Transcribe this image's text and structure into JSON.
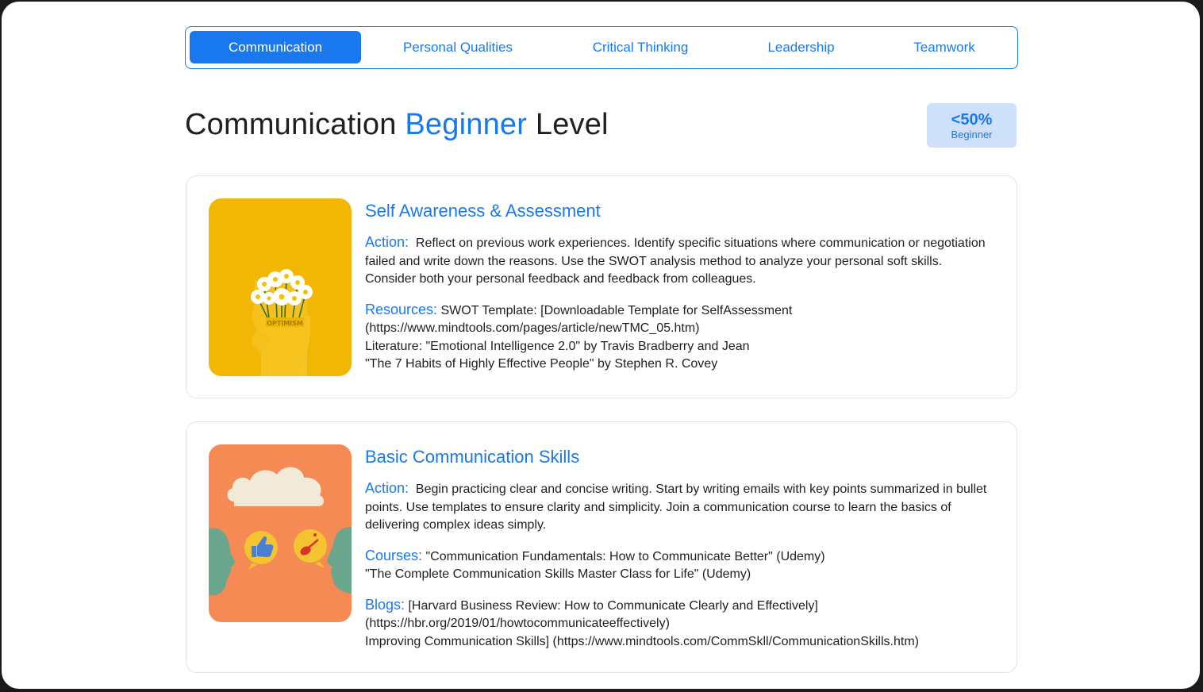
{
  "tabs": [
    {
      "label": "Communication",
      "active": true
    },
    {
      "label": "Personal Qualities",
      "active": false
    },
    {
      "label": "Critical Thinking",
      "active": false
    },
    {
      "label": "Leadership",
      "active": false
    },
    {
      "label": "Teamwork",
      "active": false
    }
  ],
  "heading": {
    "prefix": "Communication",
    "accent": "Beginner",
    "suffix": "Level"
  },
  "badge": {
    "percent": "<50%",
    "level": "Beginner"
  },
  "cards": [
    {
      "title": "Self Awareness & Assessment",
      "image_text": "OPTIMISM",
      "action_label": "Action:",
      "action_text": "Reflect on previous work experiences. Identify specific situations where communication or negotiation failed and write down the reasons. Use the SWOT analysis method to analyze your personal soft skills. Consider both your personal feedback and feedback from colleagues.",
      "resources_label": "Resources:",
      "resources_lines": [
        "SWOT Template: [Downloadable Template for SelfAssessment (https://www.mindtools.com/pages/article/newTMC_05.htm)",
        " Literature: \"Emotional Intelligence 2.0\" by Travis Bradberry and Jean",
        "\"The 7 Habits of Highly Effective People\" by Stephen R. Covey"
      ]
    },
    {
      "title": "Basic Communication Skills",
      "action_label": "Action:",
      "action_text": "Begin practicing clear and concise writing. Start by writing emails with key points summarized in bullet points. Use templates to ensure clarity and simplicity. Join a communication course to learn the basics of delivering complex ideas simply.",
      "courses_label": "Courses:",
      "courses_lines": [
        "\"Communication Fundamentals: How to Communicate Better\" (Udemy)",
        "\"The Complete Communication Skills Master Class for Life\" (Udemy)"
      ],
      "blogs_label": "Blogs:",
      "blogs_lines": [
        "[Harvard Business Review: How to Communicate Clearly and Effectively] (https://hbr.org/2019/01/howtocommunicateeffectively)",
        " Improving Communication Skills] (https://www.mindtools.com/CommSkll/CommunicationSkills.htm)"
      ]
    }
  ],
  "colors": {
    "accent": "#1a78ee",
    "badge_bg": "#cfe0fb",
    "card1_image_bg": "#f2b705",
    "card2_image_bg": "#f58a55"
  },
  "icons": [
    "flowers-head-illustration",
    "cloud-icon",
    "thumbs-up-icon",
    "guitar-icon"
  ]
}
